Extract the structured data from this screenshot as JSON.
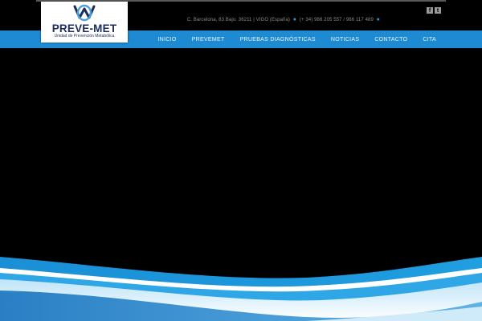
{
  "brand": {
    "name": "PREVE-MET",
    "tagline": "Unidad de Prevención Metabólica"
  },
  "contact": {
    "address": "C. Barcelona, 83 Bajo. 36211 | VIGO (España)",
    "phones": "(+ 34) 986 205 557 / 986 117 489"
  },
  "social": [
    {
      "icon": "facebook-icon",
      "glyph": "f"
    },
    {
      "icon": "twitter-icon",
      "glyph": "t"
    }
  ],
  "nav": {
    "items": [
      "INICIO",
      "PREVEMET",
      "PRUEBAS DIAGNÓSTICAS",
      "NOTICIAS",
      "CONTACTO",
      "CITA"
    ]
  },
  "colors": {
    "nav_bar": "#1e8ad1",
    "background": "#000000",
    "brand_navy": "#1c2c5e",
    "accent_blue": "#2b9ad6"
  }
}
